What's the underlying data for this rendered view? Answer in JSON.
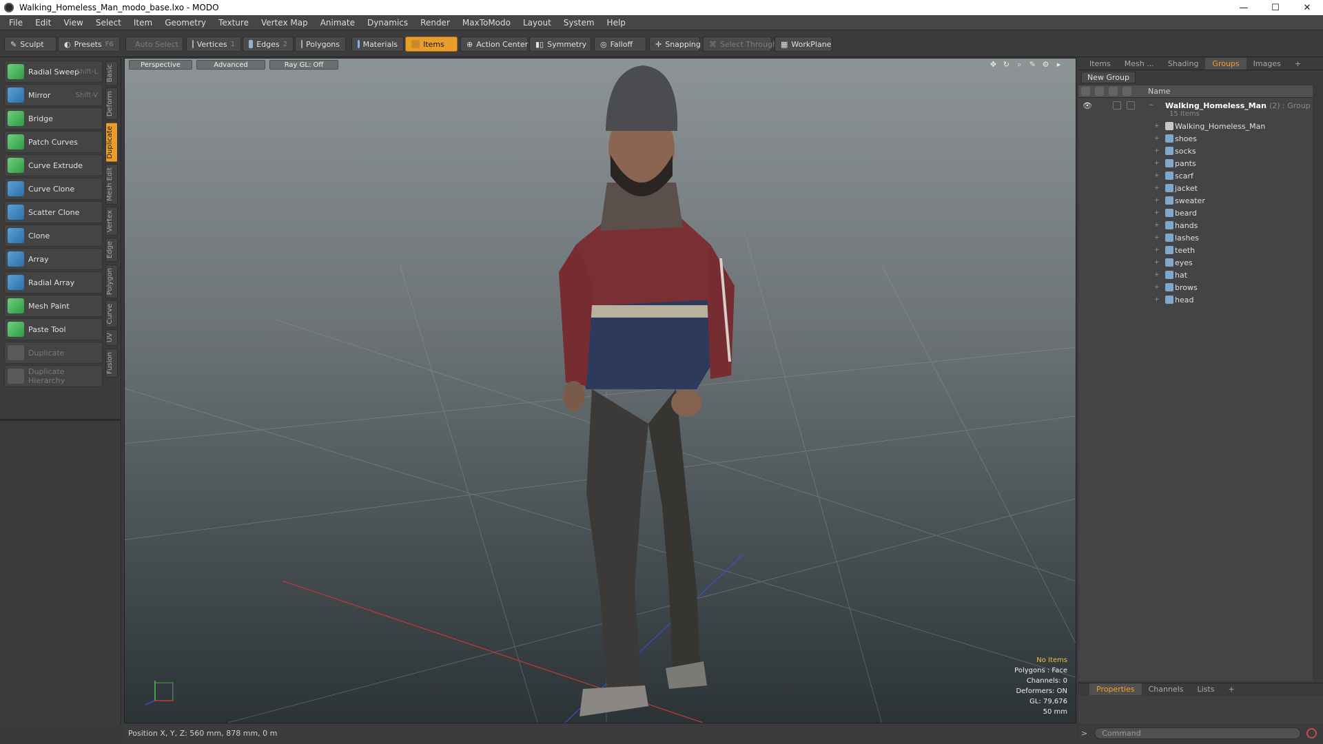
{
  "window": {
    "title": "Walking_Homeless_Man_modo_base.lxo - MODO",
    "controls": [
      "—",
      "☐",
      "✕"
    ]
  },
  "menu": [
    "File",
    "Edit",
    "View",
    "Select",
    "Item",
    "Geometry",
    "Texture",
    "Vertex Map",
    "Animate",
    "Dynamics",
    "Render",
    "MaxToModo",
    "Layout",
    "System",
    "Help"
  ],
  "toolbar": {
    "sculpt": "Sculpt",
    "presets": "Presets",
    "presets_key": "F6",
    "auto_select": "Auto Select",
    "vertices": "Vertices",
    "vertices_key": "1",
    "edges": "Edges",
    "edges_key": "2",
    "polygons": "Polygons",
    "materials": "Materials",
    "items": "Items",
    "action_center": "Action Center",
    "symmetry": "Symmetry",
    "falloff": "Falloff",
    "snapping": "Snapping",
    "select_through": "Select Through",
    "workplane": "WorkPlane"
  },
  "tools": [
    {
      "label": "Radial Sweep",
      "key": "Shift-L"
    },
    {
      "label": "Mirror",
      "key": "Shift-V"
    },
    {
      "label": "Bridge",
      "key": ""
    },
    {
      "label": "Patch Curves",
      "key": ""
    },
    {
      "label": "Curve Extrude",
      "key": ""
    },
    {
      "label": "Curve Clone",
      "key": ""
    },
    {
      "label": "Scatter Clone",
      "key": ""
    },
    {
      "label": "Clone",
      "key": ""
    },
    {
      "label": "Array",
      "key": ""
    },
    {
      "label": "Radial Array",
      "key": ""
    },
    {
      "label": "Mesh Paint",
      "key": ""
    },
    {
      "label": "Paste Tool",
      "key": ""
    },
    {
      "label": "Duplicate",
      "key": ""
    },
    {
      "label": "Duplicate Hierarchy",
      "key": ""
    }
  ],
  "side_tabs": [
    "Basic",
    "Deform",
    "Duplicate",
    "Mesh Edit",
    "Vertex",
    "Edge",
    "Polygon",
    "Curve",
    "UV",
    "Fusion"
  ],
  "viewport": {
    "view": "Perspective",
    "shading": "Advanced",
    "raygl": "Ray GL: Off",
    "stats": {
      "items": "No Items",
      "polygons": "Polygons : Face",
      "channels": "Channels: 0",
      "deformers": "Deformers: ON",
      "gl": "GL: 79,676",
      "lens": "50 mm"
    },
    "status_color": "#f0c040"
  },
  "statusbar": {
    "position": "Position X, Y, Z:  560 mm, 878 mm, 0 m"
  },
  "right_panel": {
    "tabs": [
      "Items",
      "Mesh ...",
      "Shading",
      "Groups",
      "Images",
      "+"
    ],
    "new_group": "New Group",
    "name_header": "Name",
    "group": {
      "name": "Walking_Homeless_Man",
      "meta": "(2) : Group",
      "count": "15 Items"
    },
    "items": [
      "Walking_Homeless_Man",
      "shoes",
      "socks",
      "pants",
      "scarf",
      "jacket",
      "sweater",
      "beard",
      "hands",
      "lashes",
      "teeth",
      "eyes",
      "hat",
      "brows",
      "head"
    ],
    "props_tabs": [
      "Properties",
      "Channels",
      "Lists",
      "+"
    ]
  },
  "command": {
    "prompt": ">",
    "placeholder": "Command"
  },
  "accent": "#e89d2c"
}
